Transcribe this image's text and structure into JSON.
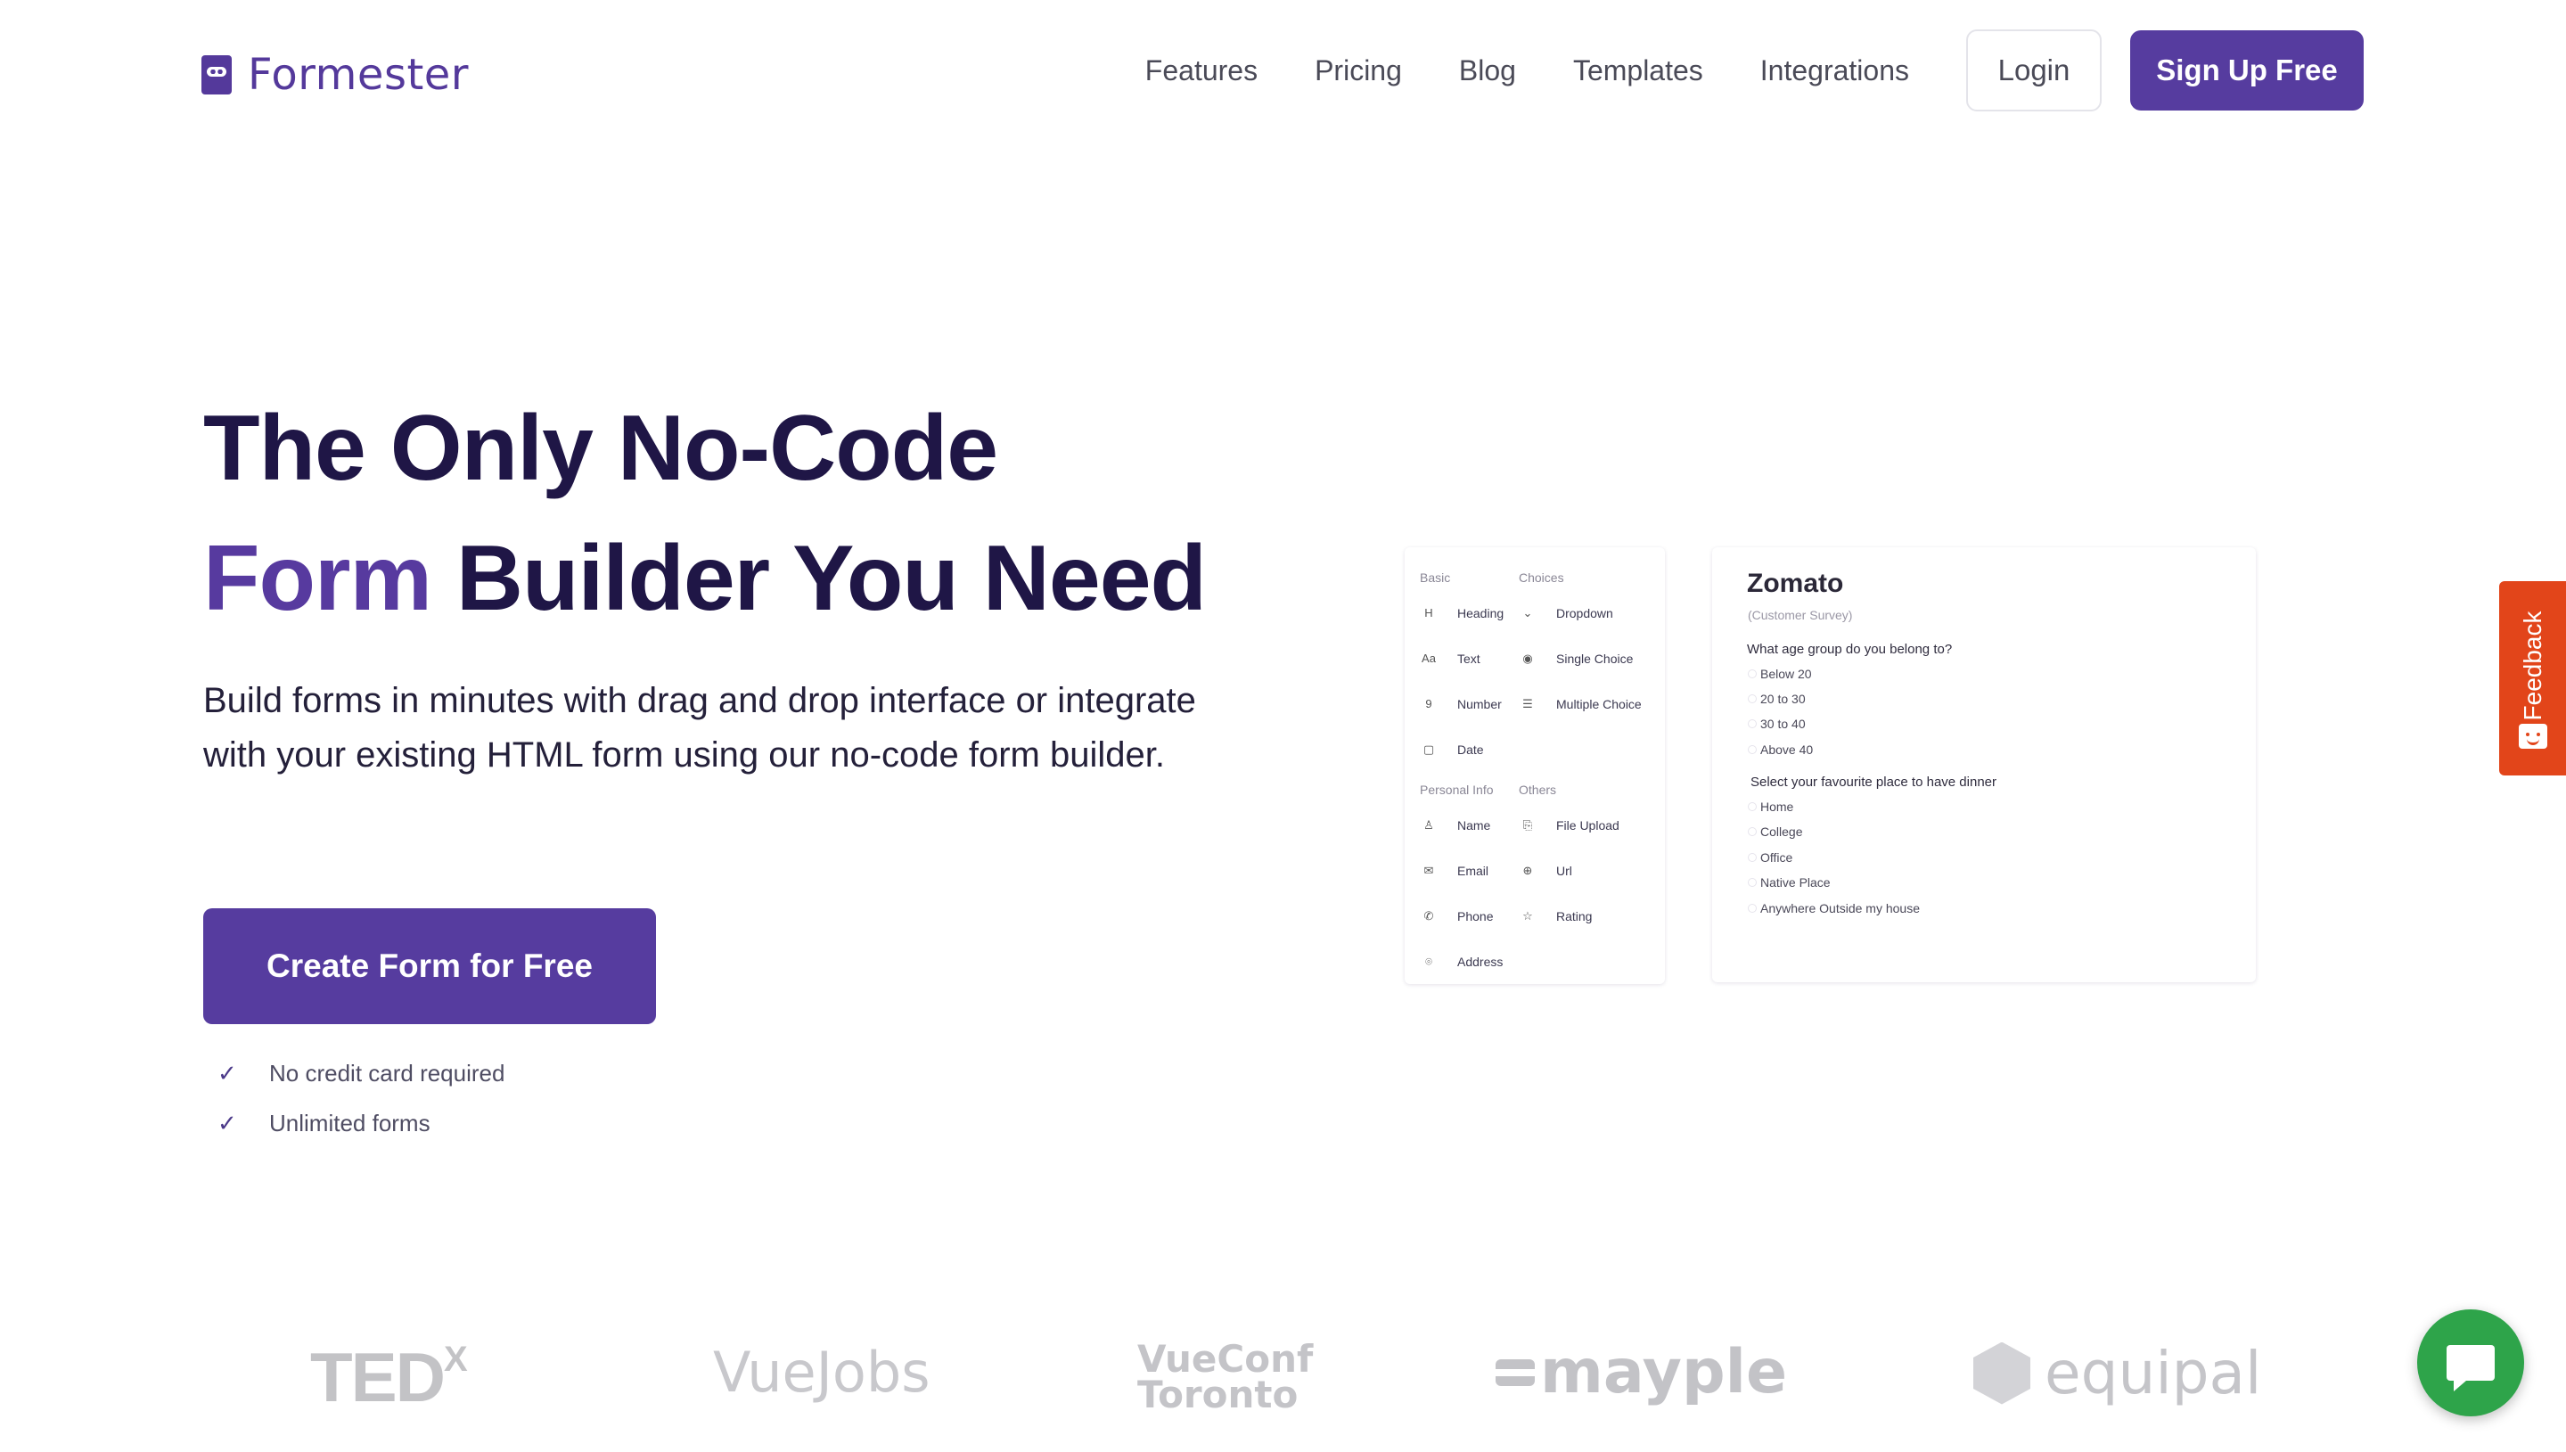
{
  "brand": {
    "name": "Formester",
    "color": "#54399b"
  },
  "nav": {
    "links": [
      "Features",
      "Pricing",
      "Blog",
      "Templates",
      "Integrations"
    ],
    "login": "Login",
    "signup": "Sign Up Free"
  },
  "hero": {
    "title_line1": "The Only No-Code",
    "title_accent": "Form",
    "title_line2_rest": " Builder You Need",
    "subtitle": "Build forms in minutes with drag and drop interface or integrate with your existing HTML form using our no-code form builder.",
    "cta": "Create Form for Free",
    "checks": [
      "No credit card required",
      "Unlimited forms"
    ]
  },
  "builder": {
    "basic_label": "Basic",
    "basic": [
      {
        "icon": "heading-icon",
        "glyph": "H",
        "label": "Heading"
      },
      {
        "icon": "text-icon",
        "glyph": "Aa",
        "label": "Text"
      },
      {
        "icon": "number-icon",
        "glyph": "9",
        "label": "Number"
      },
      {
        "icon": "calendar-icon",
        "glyph": "▢",
        "label": "Date"
      }
    ],
    "choices_label": "Choices",
    "choices": [
      {
        "icon": "dropdown-icon",
        "glyph": "⌄",
        "label": "Dropdown"
      },
      {
        "icon": "radio-icon",
        "glyph": "◉",
        "label": "Single Choice"
      },
      {
        "icon": "list-icon",
        "glyph": "☰",
        "label": "Multiple Choice"
      }
    ],
    "personal_label": "Personal Info",
    "personal": [
      {
        "icon": "user-icon",
        "glyph": "♙",
        "label": "Name"
      },
      {
        "icon": "mail-icon",
        "glyph": "✉",
        "label": "Email"
      },
      {
        "icon": "phone-icon",
        "glyph": "✆",
        "label": "Phone"
      },
      {
        "icon": "location-icon",
        "glyph": "⌾",
        "label": "Address"
      }
    ],
    "others_label": "Others",
    "others": [
      {
        "icon": "paperclip-icon",
        "glyph": "⎘",
        "label": "File Upload"
      },
      {
        "icon": "globe-icon",
        "glyph": "⊕",
        "label": "Url"
      },
      {
        "icon": "star-icon",
        "glyph": "☆",
        "label": "Rating"
      }
    ]
  },
  "survey": {
    "title": "Zomato",
    "subtitle": "(Customer Survey)",
    "q1": "What age group do you belong to?",
    "q1_options": [
      "Below 20",
      "20 to 30",
      "30 to 40",
      "Above 40"
    ],
    "q2": "Select your favourite place to have dinner",
    "q2_options": [
      "Home",
      "College",
      "Office",
      "Native Place",
      "Anywhere Outside my house"
    ]
  },
  "feedback": {
    "label": "Feedback",
    "color": "#e2451a"
  },
  "logos": {
    "tedx": "TED",
    "tedx_sup": "X",
    "vuejobs": "VueJobs",
    "vueconf_1": "VueConf",
    "vueconf_2": "Toronto",
    "mayple": "mayple",
    "equipal": "equipal"
  },
  "chat": {
    "icon": "chat-icon",
    "color": "#2ea44a"
  }
}
